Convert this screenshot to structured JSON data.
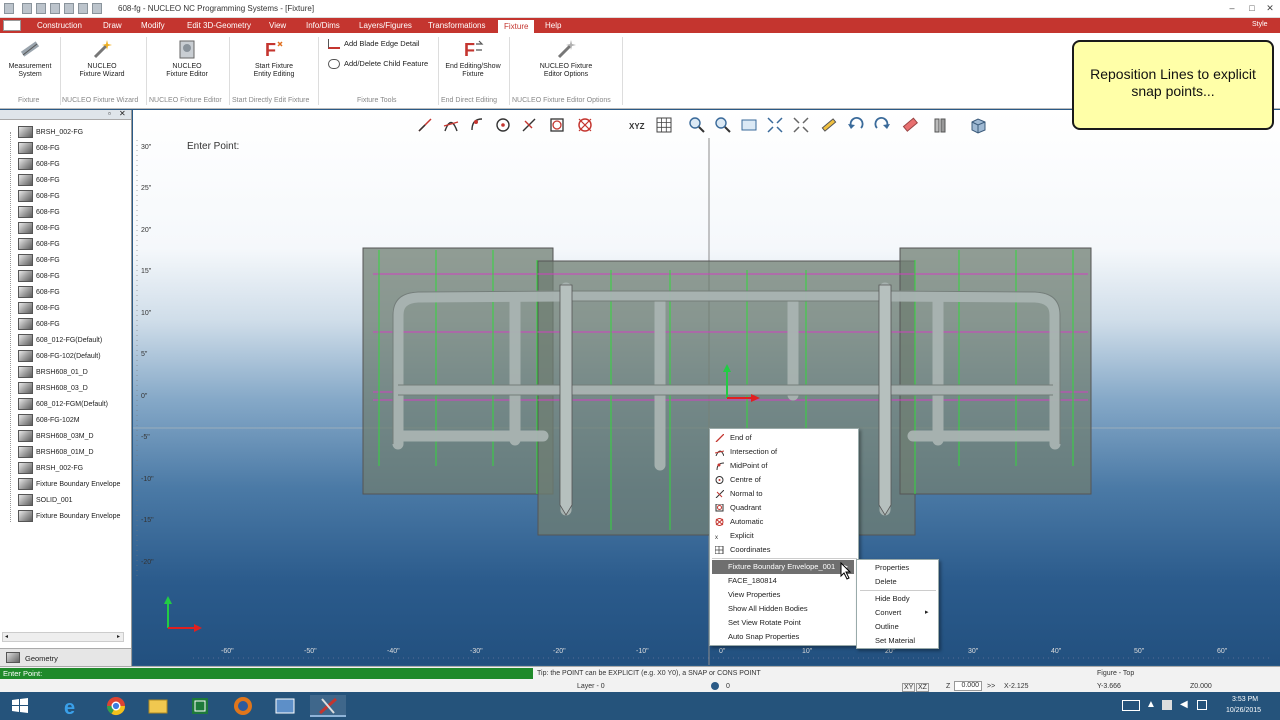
{
  "window": {
    "title": "608-fg - NUCLEO NC Programming Systems - [Fixture]",
    "style_label": "Style"
  },
  "menu": {
    "tabs": [
      "Construction",
      "Draw",
      "Modify",
      "Edit 3D-Geometry",
      "View",
      "Info/Dims",
      "Layers/Figures",
      "Transformations",
      "Fixture",
      "Help"
    ],
    "active": "Fixture"
  },
  "ribbon": {
    "measurement_system": "Measurement\nSystem",
    "nucleo_fixture_wizard": "NUCLEO\nFixture Wizard",
    "nucleo_fixture_editor": "NUCLEO\nFixture Editor",
    "start_fixture_entity_editing": "Start Fixture\nEntity Editing",
    "add_blade_edge_detail": "Add Blade Edge Detail",
    "add_delete_child_feature": "Add/Delete Child Feature",
    "end_editing_show_fixture": "End Editing/Show\nFixture",
    "nucleo_fixture_editor_options": "NUCLEO Fixture\nEditor Options",
    "groups": [
      "Fixture",
      "NUCLEO Fixture Wizard",
      "NUCLEO Fixture Editor",
      "Start Directly Edit Fixture",
      "Fixture Tools",
      "End Direct Editing",
      "NUCLEO Fixture Editor Options"
    ]
  },
  "tree": {
    "items": [
      "BRSH_002-FG",
      "608-FG",
      "608-FG",
      "608-FG",
      "608-FG",
      "608-FG",
      "608-FG",
      "608-FG",
      "608-FG",
      "608-FG",
      "608-FG",
      "608-FG",
      "608-FG",
      "608_012-FG(Default)",
      "608-FG-102(Default)",
      "BRSH608_01_D",
      "BRSH608_03_D",
      "608_012-FGM(Default)",
      "608-FG-102M",
      "BRSH608_03M_D",
      "BRSH608_01M_D",
      "BRSH_002-FG",
      "Fixture Boundary Envelope",
      "SOLID_001",
      "Fixture Boundary Envelope"
    ],
    "bottom_tab": "Geometry"
  },
  "viewport": {
    "prompt_text": "Enter Point:",
    "y_ticks": [
      "30\"",
      "25\"",
      "20\"",
      "15\"",
      "10\"",
      "5\"",
      "0\"",
      "-5\"",
      "-10\"",
      "-15\"",
      "-20\""
    ],
    "x_ticks": [
      "-60\"",
      "-50\"",
      "-40\"",
      "-30\"",
      "-20\"",
      "-10\"",
      "0\"",
      "10\"",
      "20\"",
      "30\"",
      "40\"",
      "50\"",
      "60\""
    ]
  },
  "snap_menu": {
    "items": [
      "End of",
      "Intersection of",
      "MidPoint of",
      "Centre of",
      "Normal to",
      "Quadrant",
      "Automatic",
      "Explicit",
      "Coordinates"
    ],
    "object_items": [
      "Fixture Boundary Envelope_001",
      "FACE_180814",
      "View Properties",
      "Show All Hidden Bodies",
      "Set View Rotate Point",
      "Auto Snap Properties"
    ],
    "highlighted": "Fixture Boundary Envelope_001"
  },
  "sub_menu": {
    "items": [
      "Properties",
      "Delete",
      "Hide Body",
      "Convert",
      "Outline",
      "Set Material"
    ]
  },
  "note": {
    "text": "Reposition Lines to explicit snap points..."
  },
  "status": {
    "prompt": "Enter Point:",
    "tip": "Tip: the POINT can be EXPLICIT (e.g. X0 Y0), a SNAP or CONS POINT",
    "layer": "Layer - 0",
    "layer_value": "0",
    "xy": "XY",
    "xz": "XZ",
    "z_label": "Z",
    "z_value": "0.000",
    "x_value": "X-2.125",
    "y_value": "Y-3.666",
    "figure": "Figure - Top",
    "z0": "Z0.000"
  },
  "taskbar": {
    "time": "3:53 PM",
    "date": "10/26/2015"
  }
}
